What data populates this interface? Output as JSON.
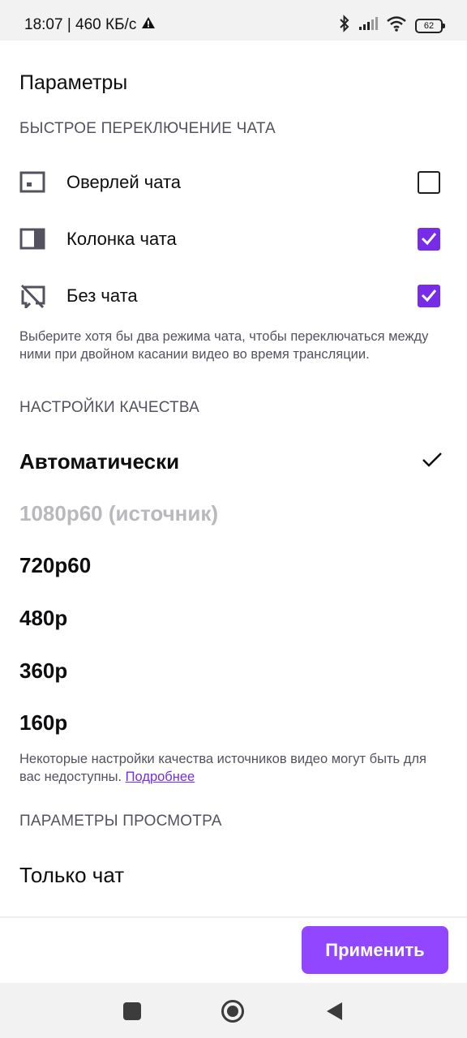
{
  "status_bar": {
    "time_speed": "18:07 | 460 КБ/с",
    "battery": "62"
  },
  "page": {
    "title": "Параметры"
  },
  "chat_switch": {
    "header": "БЫСТРОЕ ПЕРЕКЛЮЧЕНИЕ ЧАТА",
    "items": [
      {
        "label": "Оверлей чата",
        "icon": "chat-overlay-icon",
        "checked": false
      },
      {
        "label": "Колонка чата",
        "icon": "chat-column-icon",
        "checked": true
      },
      {
        "label": "Без чата",
        "icon": "no-chat-icon",
        "checked": true
      }
    ],
    "helper": "Выберите хотя бы два режима чата, чтобы переключаться между ними при двойном касании видео во время трансляции."
  },
  "quality": {
    "header": "НАСТРОЙКИ КАЧЕСТВА",
    "options": [
      {
        "label": "Автоматически",
        "selected": true,
        "disabled": false
      },
      {
        "label": "1080p60 (источник)",
        "selected": false,
        "disabled": true
      },
      {
        "label": "720p60",
        "selected": false,
        "disabled": false
      },
      {
        "label": "480p",
        "selected": false,
        "disabled": false
      },
      {
        "label": "360p",
        "selected": false,
        "disabled": false
      },
      {
        "label": "160p",
        "selected": false,
        "disabled": false
      }
    ],
    "helper": "Некоторые настройки качества источников видео могут быть для вас недоступны.",
    "learn_more": "Подробнее"
  },
  "watch": {
    "header": "ПАРАМЕТРЫ ПРОСМОТРА",
    "chat_only": "Только чат"
  },
  "footer": {
    "apply_label": "Применить"
  },
  "colors": {
    "accent": "#772ce8",
    "button": "#9147ff",
    "muted_text": "#53535f",
    "disabled_text": "#b8b8bd"
  }
}
